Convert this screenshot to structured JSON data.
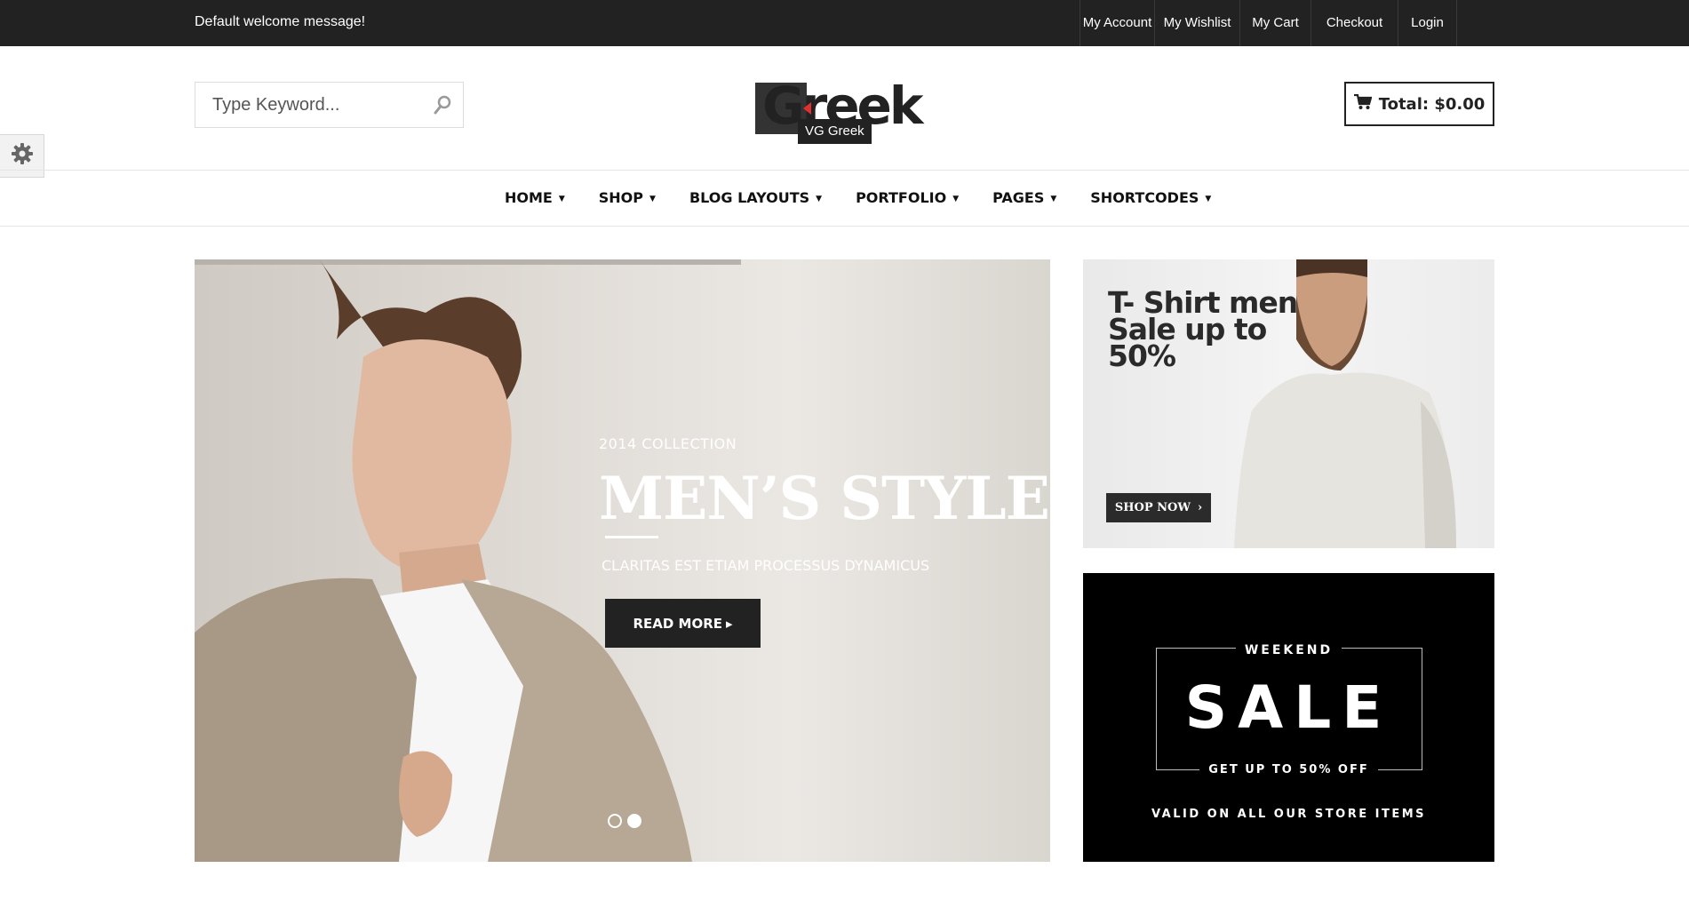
{
  "topbar": {
    "welcome": "Default welcome message!",
    "links": [
      "My Account",
      "My Wishlist",
      "My Cart",
      "Checkout",
      "Login"
    ]
  },
  "header": {
    "search_placeholder": "Type Keyword...",
    "logo_text": "Greek",
    "logo_tooltip": "VG Greek",
    "cart_total": "Total: $0.00"
  },
  "nav": {
    "items": [
      "HOME",
      "SHOP",
      "BLOG LAYOUTS",
      "PORTFOLIO",
      "PAGES",
      "SHORTCODES"
    ]
  },
  "hero": {
    "subtitle": "2014 COLLECTION",
    "title": "MEN’S STYLE",
    "description": "CLARITAS EST ETIAM PROCESSUS DYNAMICUS",
    "button": "READ MORE",
    "slides": 2,
    "active_slide": 2
  },
  "banner1": {
    "headline": "T- Shirt men Sale up to 50%",
    "button": "SHOP NOW"
  },
  "banner2": {
    "kicker": "WEEKEND",
    "title": "SALE",
    "offer": "GET UP TO 50% OFF",
    "footer": "VALID ON ALL OUR STORE ITEMS"
  },
  "colors": {
    "topbar_bg": "#222222",
    "accent_red": "#e03030",
    "button_bg": "#222222"
  }
}
